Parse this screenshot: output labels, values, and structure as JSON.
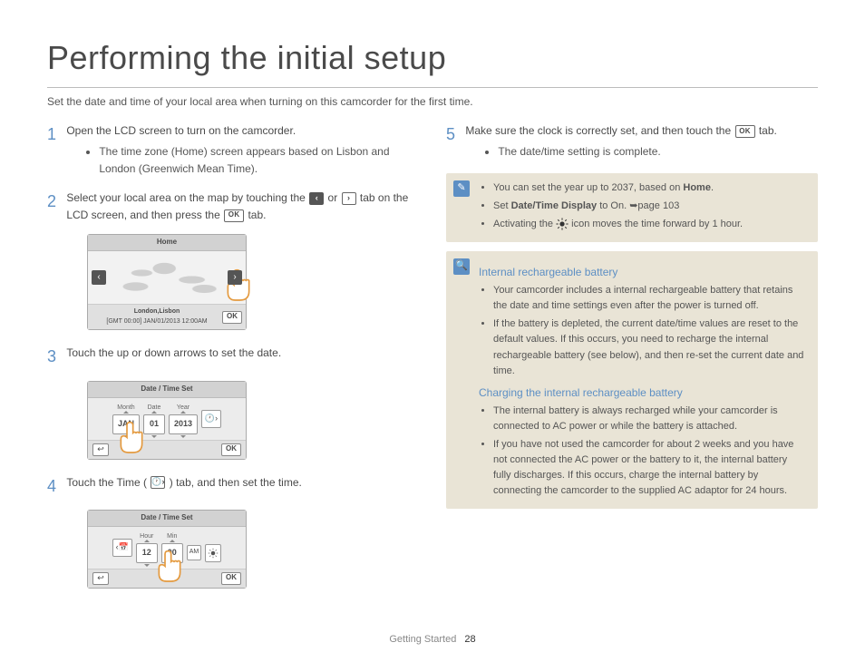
{
  "title": "Performing the initial setup",
  "intro": "Set the date and time of your local area when turning on this camcorder for the first time.",
  "steps": {
    "s1": {
      "num": "1",
      "text": "Open the LCD screen to turn on the camcorder.",
      "bullet": "The time zone (Home) screen appears based on Lisbon and London (Greenwich Mean Time)."
    },
    "s2": {
      "num": "2",
      "text_a": "Select your local area on the map by touching the ",
      "text_b": " or ",
      "text_c": " tab on the LCD screen, and then press the ",
      "text_d": " tab.",
      "shot": {
        "title": "Home",
        "city": "London,Lisbon",
        "timecode": "[GMT 00:00] JAN/01/2013 12:00AM",
        "ok": "OK"
      }
    },
    "s3": {
      "num": "3",
      "text": "Touch the up or down arrows to set the date.",
      "shot": {
        "title": "Date / Time Set",
        "labels": {
          "month": "Month",
          "date": "Date",
          "year": "Year"
        },
        "values": {
          "month": "JAN",
          "date": "01",
          "year": "2013"
        },
        "ok": "OK"
      }
    },
    "s4": {
      "num": "4",
      "text_a": "Touch the Time (",
      "text_b": ") tab, and then set the time.",
      "shot": {
        "title": "Date / Time Set",
        "labels": {
          "hour": "Hour",
          "min": "Min"
        },
        "values": {
          "hour": "12",
          "min": "00",
          "ampm": "AM"
        },
        "ok": "OK"
      }
    },
    "s5": {
      "num": "5",
      "text_a": "Make sure the clock is correctly set, and then touch the ",
      "text_b": " tab.",
      "bullet": "The date/time setting is complete."
    }
  },
  "notes": {
    "n1": {
      "b1_a": "You can set the year up to 2037, based on ",
      "b1_bold": "Home",
      "b1_b": ".",
      "b2_a": "Set ",
      "b2_bold": "Date/Time Display",
      "b2_b": " to On. ➥page 103",
      "b3_a": "Activating the ",
      "b3_b": " icon moves the time forward by 1 hour."
    },
    "n2": {
      "h1": "Internal rechargeable battery",
      "b1": "Your camcorder includes a internal rechargeable battery that retains the date and time settings even after the power is turned off.",
      "b2": "If the battery is depleted, the current date/time values are reset to the default values. If this occurs, you need to recharge the internal rechargeable battery (see below), and then re-set the current date and time.",
      "h2": "Charging the internal rechargeable battery",
      "b3": "The internal battery is always recharged while your camcorder is connected to AC power or while the battery is attached.",
      "b4": "If you have not used the camcorder for about 2 weeks and you have not connected the AC power or the battery to it, the internal battery fully discharges. If this occurs, charge the internal battery by connecting the camcorder to the supplied AC adaptor for 24 hours."
    }
  },
  "footer": {
    "section": "Getting Started",
    "page": "28"
  },
  "labels": {
    "ok": "OK",
    "left": "‹",
    "right": "›"
  }
}
